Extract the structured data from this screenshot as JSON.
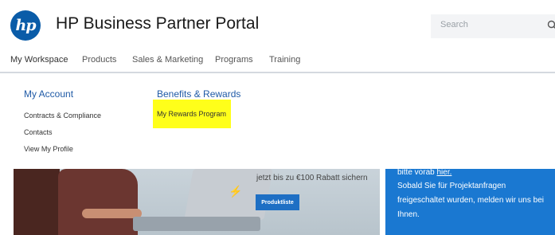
{
  "header": {
    "logo_text": "hp",
    "app_title": "HP Business Partner Portal",
    "search_placeholder": "Search"
  },
  "nav": {
    "items": [
      {
        "label": "My Workspace",
        "active": true
      },
      {
        "label": "Products"
      },
      {
        "label": "Sales & Marketing"
      },
      {
        "label": "Programs"
      },
      {
        "label": "Training"
      }
    ]
  },
  "dropdown": {
    "my_account": {
      "heading": "My Account",
      "links": [
        "Contracts & Compliance",
        "Contacts",
        "View My Profile"
      ]
    },
    "benefits": {
      "heading": "Benefits & Rewards",
      "links": [
        "My Rewards Program"
      ]
    }
  },
  "banner": {
    "promo_text": "jetzt bis zu €100 Rabatt sichern",
    "promo_button": "Produktliste",
    "info_line1_prefix": "bitte vorab",
    "info_line1_link": "hier.",
    "info_line2": "Sobald Sie für Projektanfragen",
    "info_line3": "freigeschaltet wurden, melden wir uns bei",
    "info_line4": "Ihnen."
  },
  "colors": {
    "brand_blue": "#0a5ca8",
    "heading_blue": "#1f5aa6",
    "highlight": "#ffff1a",
    "info_box": "#1a78d1"
  }
}
